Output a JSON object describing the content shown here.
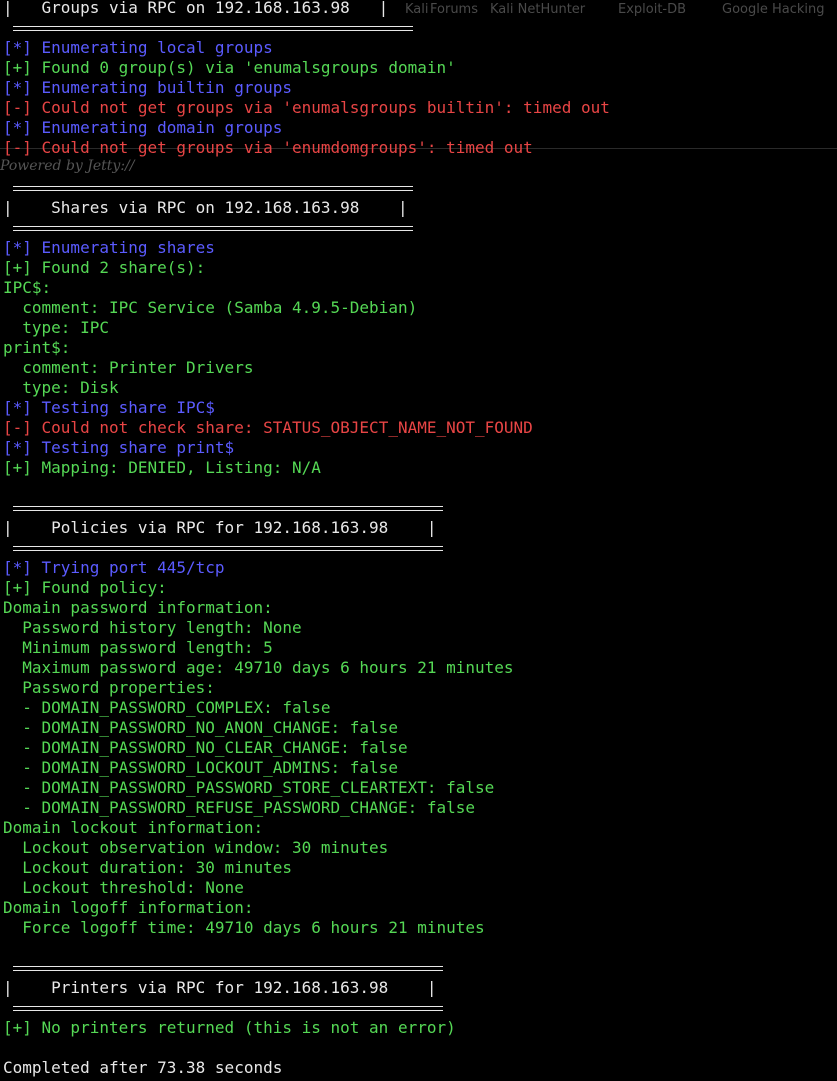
{
  "ghost": {
    "items": [
      "Kali",
      "Forums",
      "Kali NetHunter",
      "Exploit-DB",
      "Google Hacking"
    ],
    "footer": "Powered by Jetty://"
  },
  "sections": [
    {
      "header": "|   Groups via RPC on 192.168.163.98   |",
      "width": 400,
      "lines": [
        {
          "kind": "info",
          "text": "[*] Enumerating local groups"
        },
        {
          "kind": "ok",
          "text": "[+] Found 0 group(s) via 'enumalsgroups domain'"
        },
        {
          "kind": "info",
          "text": "[*] Enumerating builtin groups"
        },
        {
          "kind": "err",
          "text": "[-] Could not get groups via 'enumalsgroups builtin': timed out"
        },
        {
          "kind": "info",
          "text": "[*] Enumerating domain groups"
        },
        {
          "kind": "err",
          "text": "[-] Could not get groups via 'enumdomgroups': timed out"
        }
      ]
    },
    {
      "header": "|    Shares via RPC on 192.168.163.98    |",
      "width": 400,
      "lines": [
        {
          "kind": "info",
          "text": "[*] Enumerating shares"
        },
        {
          "kind": "ok",
          "text": "[+] Found 2 share(s):"
        },
        {
          "kind": "val",
          "text": "IPC$:"
        },
        {
          "kind": "val",
          "text": "  comment: IPC Service (Samba 4.9.5-Debian)"
        },
        {
          "kind": "val",
          "text": "  type: IPC"
        },
        {
          "kind": "val",
          "text": "print$:"
        },
        {
          "kind": "val",
          "text": "  comment: Printer Drivers"
        },
        {
          "kind": "val",
          "text": "  type: Disk"
        },
        {
          "kind": "info",
          "text": "[*] Testing share IPC$"
        },
        {
          "kind": "errmix",
          "prefix": "[-] Could not check share: ",
          "text": "STATUS_OBJECT_NAME_NOT_FOUND"
        },
        {
          "kind": "info",
          "text": "[*] Testing share print$"
        },
        {
          "kind": "ok",
          "text": "[+] Mapping: DENIED, Listing: N/A"
        },
        {
          "kind": "blank",
          "text": ""
        }
      ]
    },
    {
      "header": "|    Policies via RPC for 192.168.163.98    |",
      "width": 430,
      "lines": [
        {
          "kind": "info",
          "text": "[*] Trying port 445/tcp"
        },
        {
          "kind": "ok",
          "text": "[+] Found policy:"
        },
        {
          "kind": "val",
          "text": "Domain password information:"
        },
        {
          "kind": "val",
          "text": "  Password history length: None"
        },
        {
          "kind": "val",
          "text": "  Minimum password length: 5"
        },
        {
          "kind": "val",
          "text": "  Maximum password age: 49710 days 6 hours 21 minutes"
        },
        {
          "kind": "val",
          "text": "  Password properties:"
        },
        {
          "kind": "val",
          "text": "  - DOMAIN_PASSWORD_COMPLEX: false"
        },
        {
          "kind": "val",
          "text": "  - DOMAIN_PASSWORD_NO_ANON_CHANGE: false"
        },
        {
          "kind": "val",
          "text": "  - DOMAIN_PASSWORD_NO_CLEAR_CHANGE: false"
        },
        {
          "kind": "val",
          "text": "  - DOMAIN_PASSWORD_LOCKOUT_ADMINS: false"
        },
        {
          "kind": "val",
          "text": "  - DOMAIN_PASSWORD_PASSWORD_STORE_CLEARTEXT: false"
        },
        {
          "kind": "val",
          "text": "  - DOMAIN_PASSWORD_REFUSE_PASSWORD_CHANGE: false"
        },
        {
          "kind": "val",
          "text": "Domain lockout information:"
        },
        {
          "kind": "val",
          "text": "  Lockout observation window: 30 minutes"
        },
        {
          "kind": "val",
          "text": "  Lockout duration: 30 minutes"
        },
        {
          "kind": "val",
          "text": "  Lockout threshold: None"
        },
        {
          "kind": "val",
          "text": "Domain logoff information:"
        },
        {
          "kind": "val",
          "text": "  Force logoff time: 49710 days 6 hours 21 minutes"
        },
        {
          "kind": "blank",
          "text": ""
        }
      ]
    },
    {
      "header": "|    Printers via RPC for 192.168.163.98    |",
      "width": 430,
      "lines": [
        {
          "kind": "ok",
          "text": "[+] No printers returned (this is not an error)"
        },
        {
          "kind": "blank",
          "text": ""
        },
        {
          "kind": "white",
          "text": "Completed after 73.38 seconds"
        }
      ]
    }
  ],
  "colors": {
    "info": "#5b5bff",
    "ok": "#55d855",
    "err": "#e84545",
    "text": "#e8e8e8",
    "bg": "#000000"
  }
}
